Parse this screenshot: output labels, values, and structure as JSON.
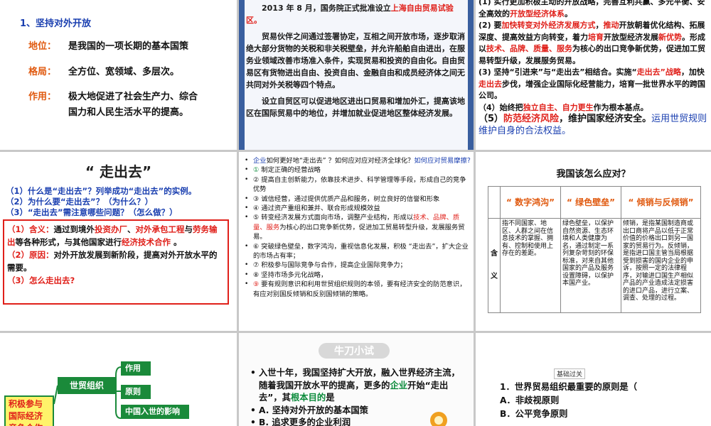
{
  "slide1": {
    "heading": "1、坚持对外开放",
    "rows": [
      {
        "label": "地位：",
        "value": "是我国的一项长期的基本国策"
      },
      {
        "label": "格局：",
        "value": "全方位、宽领域、多层次。"
      },
      {
        "label": "作用：",
        "value": "极大地促进了社会生产力、综合",
        "value2": "国力和人民生活水平的提高。"
      }
    ]
  },
  "slide2": {
    "p1_a": "2013 年 8 月，国务院正式批准设立",
    "p1_b": "上海自由贸易试验区。",
    "p2": "贸易伙伴之间通过签署协定，互相之间开放市场，逐步取消绝大部分货物的关税和非关税壁垒，并允许船舶自由进出，在服务业领域改善市场准入条件，实现贸易和投资的自由化。自由贸易区有货物进出自由、投资自由、金融自由和成员经济体之间无共同对外关税等四个特点。",
    "p3": "设立自贸区可以促进地区进出口贸易和增加外汇，提高该地区在国际贸易中的地位，并增加就业促进地区整体经济发展。"
  },
  "slide3": {
    "l1_a": "(1) 实行更加积极主动的开放战略，完善互利共赢、多元平衡、安全高效的",
    "l1_b": "开放型经济体系",
    "l1_c": "。",
    "l2_a": "(2) 要",
    "l2_b": "加快转变对外经济发展方式",
    "l2_c": "，",
    "l2_d": "推动",
    "l2_e": "开放朝着优化结构、拓展深度、提高效益方向转变，着力",
    "l2_f": "培育",
    "l2_g": "开放型经济发展",
    "l2_h": "新优势",
    "l2_i": "。形成以",
    "l2_j": "技术、品牌、质量、服务",
    "l2_k": "为核心的出口竞争新优势，促进加工贸易转型升级，发展服务贸易。",
    "l3_a": "(3) 坚持“引进来”与“走出去”相结合。实施“",
    "l3_b": "走出去”战略",
    "l3_c": "，加快",
    "l3_d": "走出去",
    "l3_e": "步伐，增强企业国际化经营能力，培育一批世界水平的跨国公司。",
    "l4_a": "（4）始终把",
    "l4_b": "独立自主、自力更生",
    "l4_c": "作为根本基点。",
    "l5_a": "（5）",
    "l5_b": "防范经济风险",
    "l5_c": "，维护国家经济安全。",
    "l5_d": "运用世贸规则维护自身的合法权益。"
  },
  "slide4": {
    "title": "“ 走出去”",
    "q1": "（1）什么是“走出去”？列举成功“走出去”的实例。",
    "q2": "（2）为什么要“走出去”？（为什么？）",
    "q3": "（3）“走出去”需注意哪些问题？（怎么做？）",
    "a1_a": "（1）含义：",
    "a1_b": "通过到境外",
    "a1_c": "投资办厂",
    "a1_d": "、",
    "a1_e": "对外承包工程",
    "a1_f": "与",
    "a1_g": "劳务输出",
    "a1_h": "等各种形式，与其他国家进行",
    "a1_i": "经济技术合作",
    "a1_j": " 。",
    "a2_a": "（2）原因：",
    "a2_b": "对外开放发展到新阶段，提高对外开放水平的需要。",
    "a3": "（3）怎么走出去?"
  },
  "slide5": {
    "items": [
      {
        "bullet": "•",
        "parts": [
          {
            "t": "企业",
            "c": "blue"
          },
          {
            "t": "如何更好地“走出去” ？如何应对应对经济全球化？",
            "c": ""
          },
          {
            "t": "如何应对贸易摩擦?",
            "c": "blue"
          }
        ]
      },
      {
        "bullet": "•",
        "parts": [
          {
            "t": "① ",
            "c": "green"
          },
          {
            "t": "制定正确的经营战略",
            "c": ""
          }
        ]
      },
      {
        "bullet": "•",
        "parts": [
          {
            "t": "② 提高自主创新能力，依靠技术进步、科学管理等手段，形成自己的竞争优势",
            "c": ""
          }
        ]
      },
      {
        "bullet": "•",
        "parts": [
          {
            "t": "③ 诚信经营，通过提供优质产品和服务，树立良好的信誉和形象",
            "c": ""
          }
        ]
      },
      {
        "bullet": "•",
        "parts": [
          {
            "t": "④  通过资产重组和兼并、联合形成规模效益",
            "c": ""
          }
        ]
      },
      {
        "bullet": "•",
        "parts": [
          {
            "t": "⑤ 转变经济发展方式面向市场，调整产业结构，形成以",
            "c": ""
          },
          {
            "t": "技术、品牌、质量、服务",
            "c": "red"
          },
          {
            "t": "为核心的出口竞争新优势，促进加工贸易转型升级，发展服务贸易。",
            "c": ""
          }
        ]
      },
      {
        "bullet": "•",
        "parts": [
          {
            "t": "⑥ 突破绿色壁垒，数字鸿沟，重视信息化发展，积极 “走出去”，扩大企业的市场占有率；",
            "c": ""
          }
        ]
      },
      {
        "bullet": "•",
        "parts": [
          {
            "t": "⑦ 积极参与国际竞争与合作，提高企业国际竞争力；",
            "c": ""
          }
        ]
      },
      {
        "bullet": "•",
        "parts": [
          {
            "t": "⑧ 坚持市场多元化战略，",
            "c": ""
          }
        ]
      },
      {
        "bullet": "•",
        "parts": [
          {
            "t": "⑨ ",
            "c": "red"
          },
          {
            "t": "要有规则意识和利用世贸组织规则的本领，要有经济安全的防范意识，有应对别国反倾销和反别国倾销的策略。",
            "c": ""
          }
        ]
      }
    ]
  },
  "slide6": {
    "title": "我国该怎么应对？",
    "headers": [
      "“ 数字鸿沟”",
      "“ 绿色壁垒”",
      "“ 倾销与反倾销”"
    ],
    "side_top": "含",
    "side_bottom": "义",
    "cells": [
      "指不同国家、地区、人群之间在信息技术的掌握、拥有、控制和使用上存在的差距。",
      "绿色壁垒，以保护自然资源、生态环境和人类健康为名，通过制定一系列复杂苛刻的环保标准，对来自其他国家的产品及服务设置障碍，以保护本国产业。",
      "倾销，是指某国制造商或出口商将产品以低于正常价值的价格出口到另一国家的贸易行为。反倾销，是指进口国主管当局根据受到损害的国内企业的申诉，按照一定的法律程序，对输进口国生产相似产品的产业造成法定损害的进口产品，进行立案、调查、处理的过程。"
    ]
  },
  "slide7": {
    "left_box": "积极参与国际经济竞争合作",
    "wto": "世贸组织",
    "branches": [
      "作用",
      "原则",
      "中国入世的影响"
    ]
  },
  "slide8": {
    "banner": "牛刀小试",
    "items": [
      {
        "bullet": "•",
        "a": "入世十年，我国坚持扩大开放，融入世界经济主流，随着我国开放水平的提高，更多的",
        "b": "企业",
        "c": "开始“走出去”，其",
        "d": "根本目的",
        "e": "是"
      },
      {
        "bullet": "•",
        "a": "A. 坚持对外开放的基本国策",
        "b": "",
        "c": "",
        "d": "",
        "e": ""
      },
      {
        "bullet": "•",
        "a": "B. 追求更多的企业利润",
        "b": "",
        "c": "",
        "d": "",
        "e": ""
      }
    ]
  },
  "slide9": {
    "tag": "基础过关",
    "lines": [
      "1．世界贸易组织最重要的原则是（",
      "A．非歧视原则",
      "B．公平竞争原则"
    ]
  }
}
